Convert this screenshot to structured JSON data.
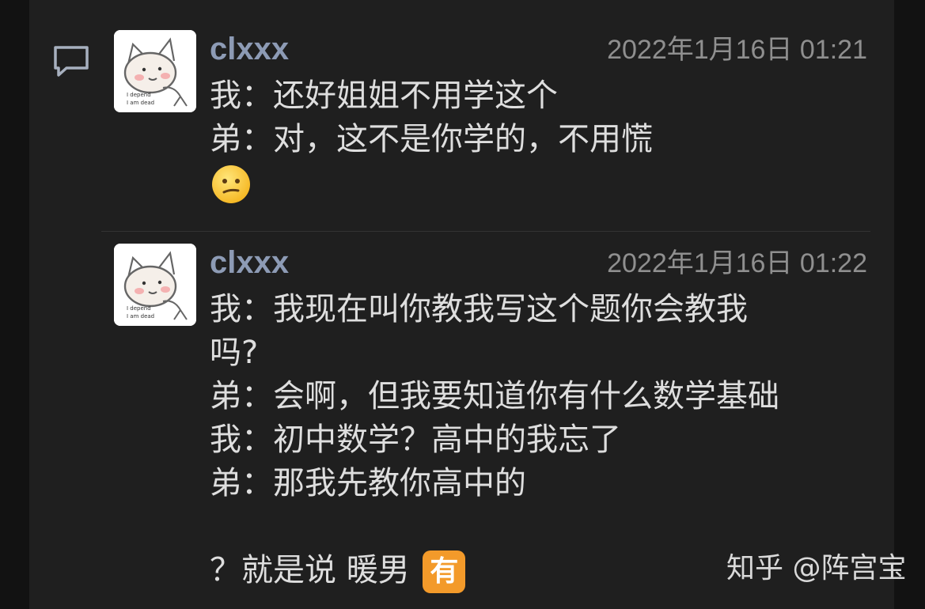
{
  "side_icon": "comment-icon",
  "messages": [
    {
      "username": "clxxx",
      "timestamp": "2022年1月16日 01:21",
      "lines": [
        "我：还好姐姐不用学这个",
        "弟：对，这不是你学的，不用慌"
      ]
    },
    {
      "username": "clxxx",
      "timestamp": "2022年1月16日 01:22",
      "lines": [
        "我：我现在叫你教我写这个题你会教我",
        "吗?",
        "弟：会啊，但我要知道你有什么数学基础",
        "我：初中数学？高中的我忘了",
        "弟：那我先教你高中的",
        "",
        "？就是说 暖男"
      ],
      "badge": "有"
    }
  ],
  "watermark": "知乎 @阵宫宝",
  "colors": {
    "panel_bg": "#1f1f1f",
    "page_bg": "#121212",
    "username": "#8d9bb5",
    "text": "#dedede",
    "timestamp": "#8f8f8f",
    "badge_bg": "#f39a2a"
  }
}
